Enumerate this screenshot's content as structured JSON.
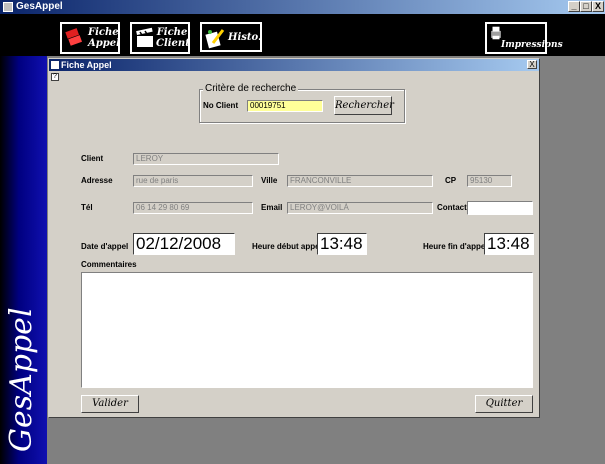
{
  "app": {
    "title": "GesAppel",
    "banner_text": "GesAppel",
    "window_buttons": {
      "minimize": "_",
      "maximize": "□",
      "close": "X"
    }
  },
  "toolbar": {
    "fiche_appel": {
      "line1": "Fiche",
      "line2": "Appel"
    },
    "fiche_client": {
      "line1": "Fiche",
      "line2": "Client"
    },
    "histo": {
      "label": "Histo."
    },
    "impressions": {
      "label": "Impressions"
    }
  },
  "child": {
    "title": "Fiche Appel",
    "close": "X",
    "help": "?"
  },
  "search": {
    "group_title": "Critère de recherche",
    "no_client_label": "No Client",
    "no_client_value": "00019751",
    "button": "Rechercher"
  },
  "client": {
    "client_label": "Client",
    "client_value": "LEROY",
    "adresse_label": "Adresse",
    "adresse_value": "rue de paris",
    "ville_label": "Ville",
    "ville_value": "FRANCONVILLE",
    "cp_label": "CP",
    "cp_value": "95130",
    "tel_label": "Tél",
    "tel_value": "06 14 29 80 69",
    "email_label": "Email",
    "email_value": "LEROY@VOILÀ",
    "contact_label": "Contact",
    "contact_value": ""
  },
  "appel": {
    "date_label": "Date d'appel",
    "date_value": "02/12/2008",
    "debut_label": "Heure début appel",
    "debut_value": "13:48",
    "fin_label": "Heure fin d'appel",
    "fin_value": "13:48",
    "comment_label": "Commentaires",
    "comment_value": ""
  },
  "actions": {
    "valider": "Valider",
    "quitter": "Quitter"
  }
}
